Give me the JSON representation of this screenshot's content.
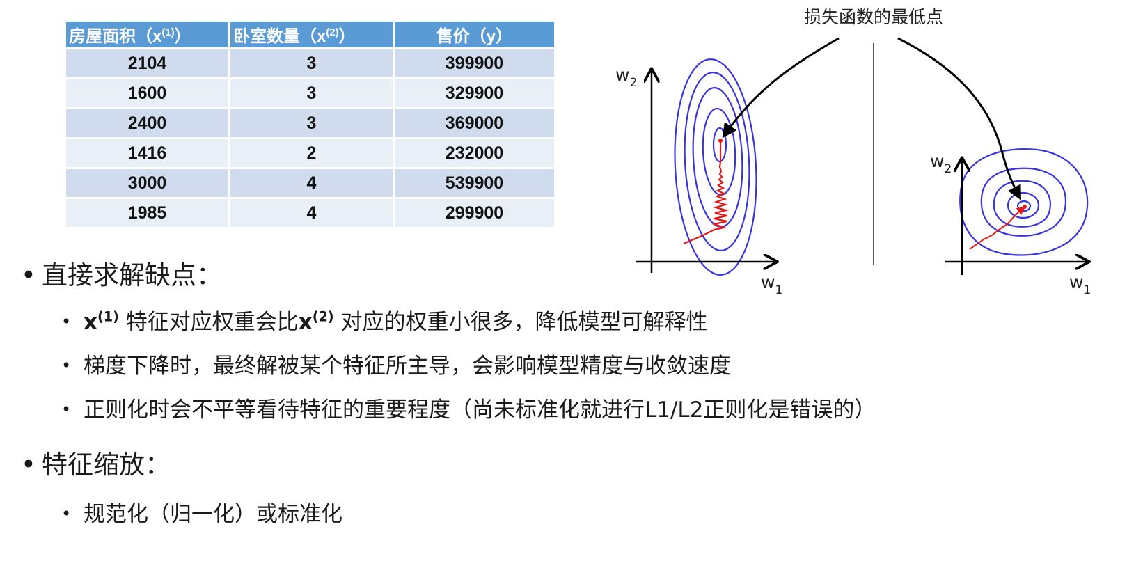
{
  "table": {
    "headers": [
      {
        "main": "房屋面积（x",
        "sup": "(1)",
        "close": "）"
      },
      {
        "main": "卧室数量（x",
        "sup": "(2)",
        "close": "）"
      },
      {
        "main": "售价（y）",
        "sup": "",
        "close": ""
      }
    ],
    "rows": [
      [
        "2104",
        "3",
        "399900"
      ],
      [
        "1600",
        "3",
        "329900"
      ],
      [
        "2400",
        "3",
        "369000"
      ],
      [
        "1416",
        "2",
        "232000"
      ],
      [
        "3000",
        "4",
        "539900"
      ],
      [
        "1985",
        "4",
        "299900"
      ]
    ]
  },
  "figure": {
    "annotation": "损失函数的最低点",
    "left_plot": {
      "x_axis": "w",
      "x_sub": "1",
      "y_axis": "w",
      "y_sub": "2"
    },
    "right_plot": {
      "x_axis": "w",
      "x_sub": "1",
      "y_axis": "w",
      "y_sub": "2"
    },
    "colors": {
      "contour": "#3a34e0",
      "path": "#e51616",
      "arrow": "#000000",
      "divider": "#555555"
    }
  },
  "bullets": {
    "heading1": "直接求解缺点：",
    "item1": {
      "x1": "x",
      "sup1": "(1)",
      "text1": "特征对应权重会比",
      "x2": "x",
      "sup2": "(2)",
      "text2": "对应的权重小很多，降低模型可解释性"
    },
    "item2": "梯度下降时，最终解被某个特征所主导，会影响模型精度与收敛速度",
    "item3": "正则化时会不平等看待特征的重要程度（尚未标准化就进行L1/L2正则化是错误的）",
    "heading2": "特征缩放：",
    "item4": "规范化（归一化）或标准化",
    "bullet_char": "•"
  }
}
